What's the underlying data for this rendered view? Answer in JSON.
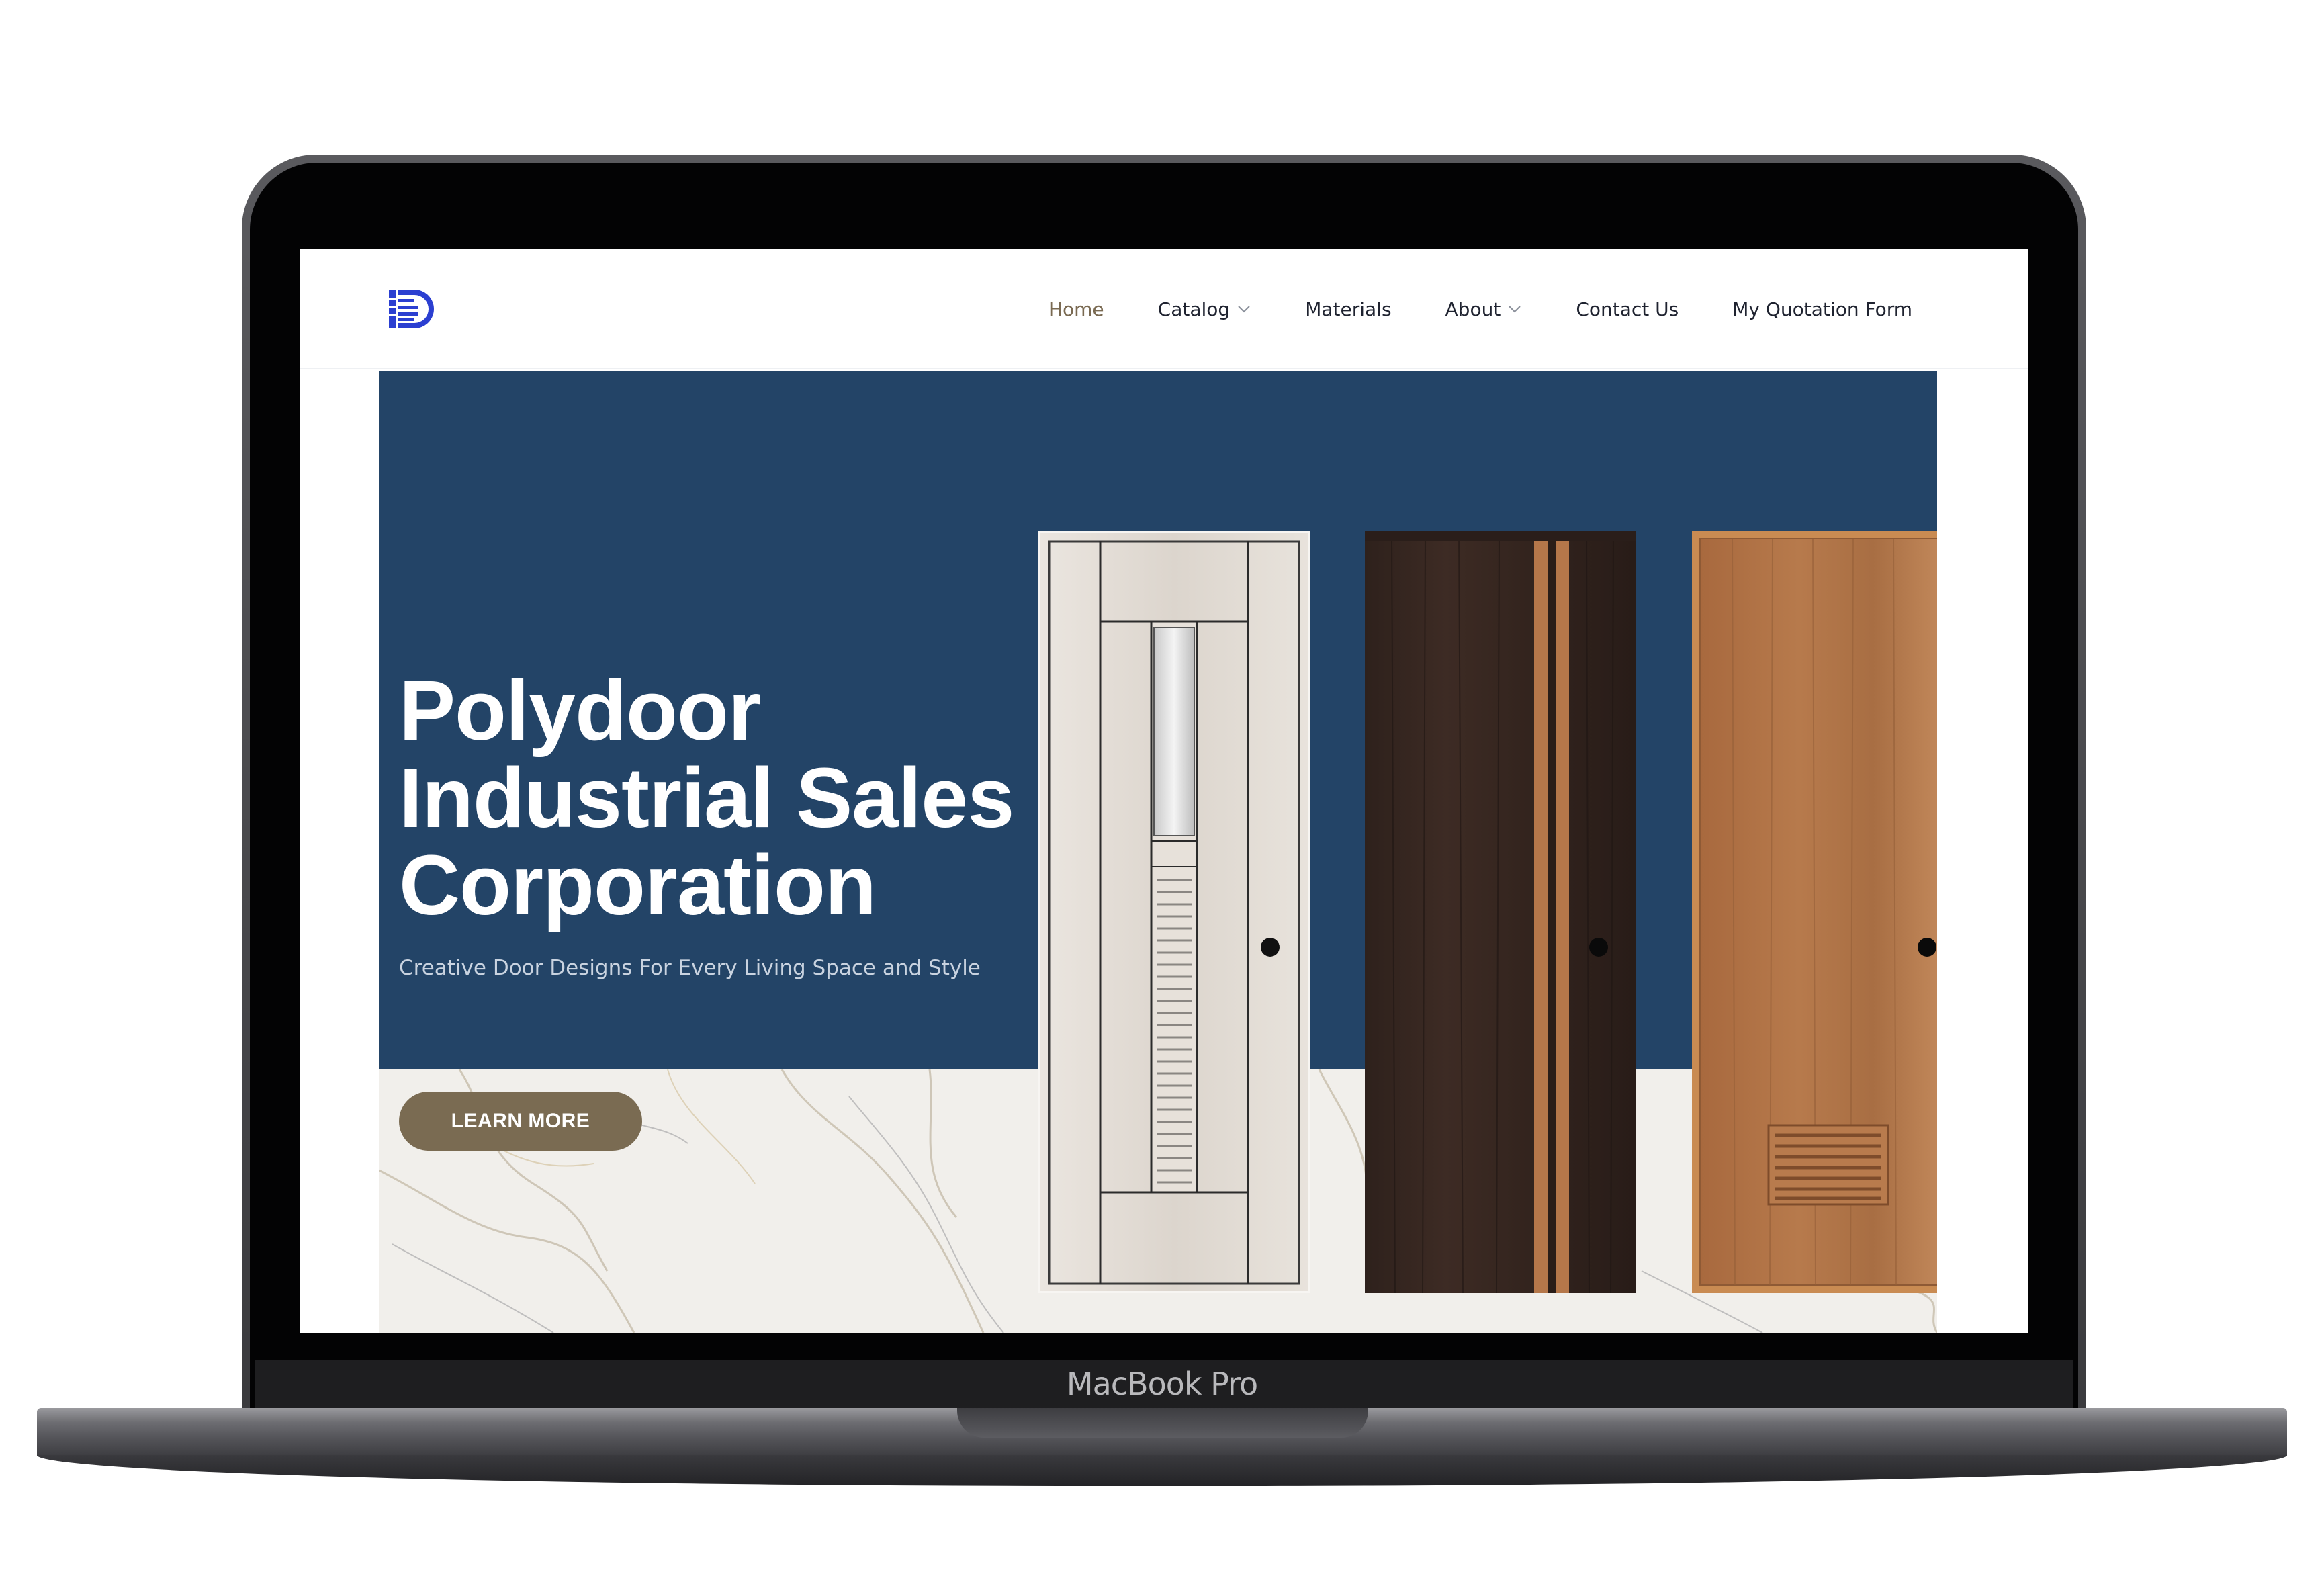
{
  "device": {
    "model_label": "MacBook Pro"
  },
  "site": {
    "logo": "polydoor-logo",
    "nav": {
      "items": [
        {
          "label": "Home",
          "active": true,
          "has_dropdown": false
        },
        {
          "label": "Catalog",
          "active": false,
          "has_dropdown": true
        },
        {
          "label": "Materials",
          "active": false,
          "has_dropdown": false
        },
        {
          "label": "About",
          "active": false,
          "has_dropdown": true
        },
        {
          "label": "Contact Us",
          "active": false,
          "has_dropdown": false
        },
        {
          "label": "My Quotation Form",
          "active": false,
          "has_dropdown": false
        }
      ]
    },
    "hero": {
      "title_line1": "Polydoor",
      "title_line2": "Industrial Sales",
      "title_line3": "Corporation",
      "subtitle": "Creative Door Designs For Every Living Space and Style",
      "cta_label": "LEARN MORE"
    }
  },
  "colors": {
    "hero_blue": "#234467",
    "accent_brown": "#7a6b52",
    "active_nav": "#7a6a52",
    "logo_blue": "#2b3fd1"
  },
  "icons": [
    "chevron-down-icon"
  ]
}
